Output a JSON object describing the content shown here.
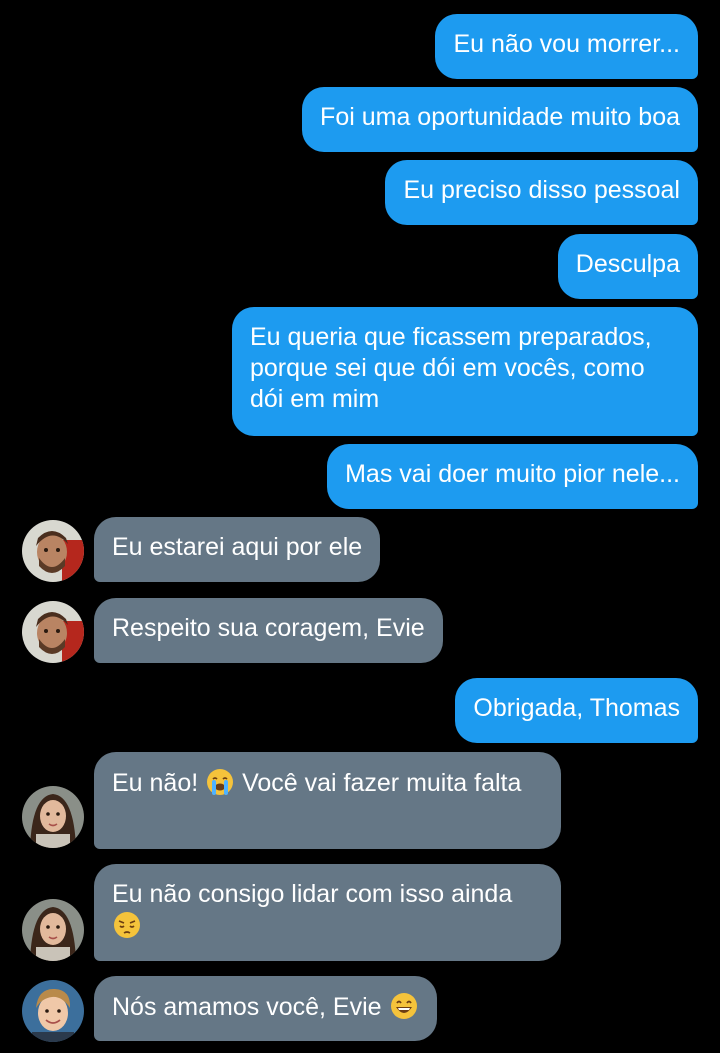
{
  "messages": [
    {
      "side": "out",
      "text": "Eu não vou morrer..."
    },
    {
      "side": "out",
      "text": "Foi uma oportunidade muito boa"
    },
    {
      "side": "out",
      "text": "Eu preciso disso pessoal"
    },
    {
      "side": "out",
      "text": "Desculpa"
    },
    {
      "side": "out",
      "text": "Eu queria que ficassem preparados, porque sei que dói em vocês, como dói em mim"
    },
    {
      "side": "out",
      "text": "Mas vai doer muito pior nele..."
    },
    {
      "side": "in",
      "sender_avatar": "thomas-avatar",
      "text": "Eu estarei aqui por ele"
    },
    {
      "side": "in",
      "sender_avatar": "thomas-avatar",
      "text": "Respeito sua coragem, Evie"
    },
    {
      "side": "out",
      "text": "Obrigada, Thomas"
    },
    {
      "side": "in",
      "sender_avatar": "woman-avatar",
      "text_before": "Eu não! ",
      "emoji": "loudly-crying-face-icon",
      "text_after": " Você vai fazer muita falta"
    },
    {
      "side": "in",
      "sender_avatar": "woman-avatar",
      "text_before": "Eu não consigo lidar com isso ainda ",
      "emoji": "pensive-face-icon",
      "text_after": ""
    },
    {
      "side": "in",
      "sender_avatar": "blond-man-avatar",
      "text_before": "Nós amamos você, Evie ",
      "emoji": "grinning-face-icon",
      "text_after": ""
    }
  ],
  "colors": {
    "background": "#000000",
    "outgoing_bubble": "#1d9bf0",
    "incoming_bubble": "#657786",
    "text": "#ffffff"
  }
}
